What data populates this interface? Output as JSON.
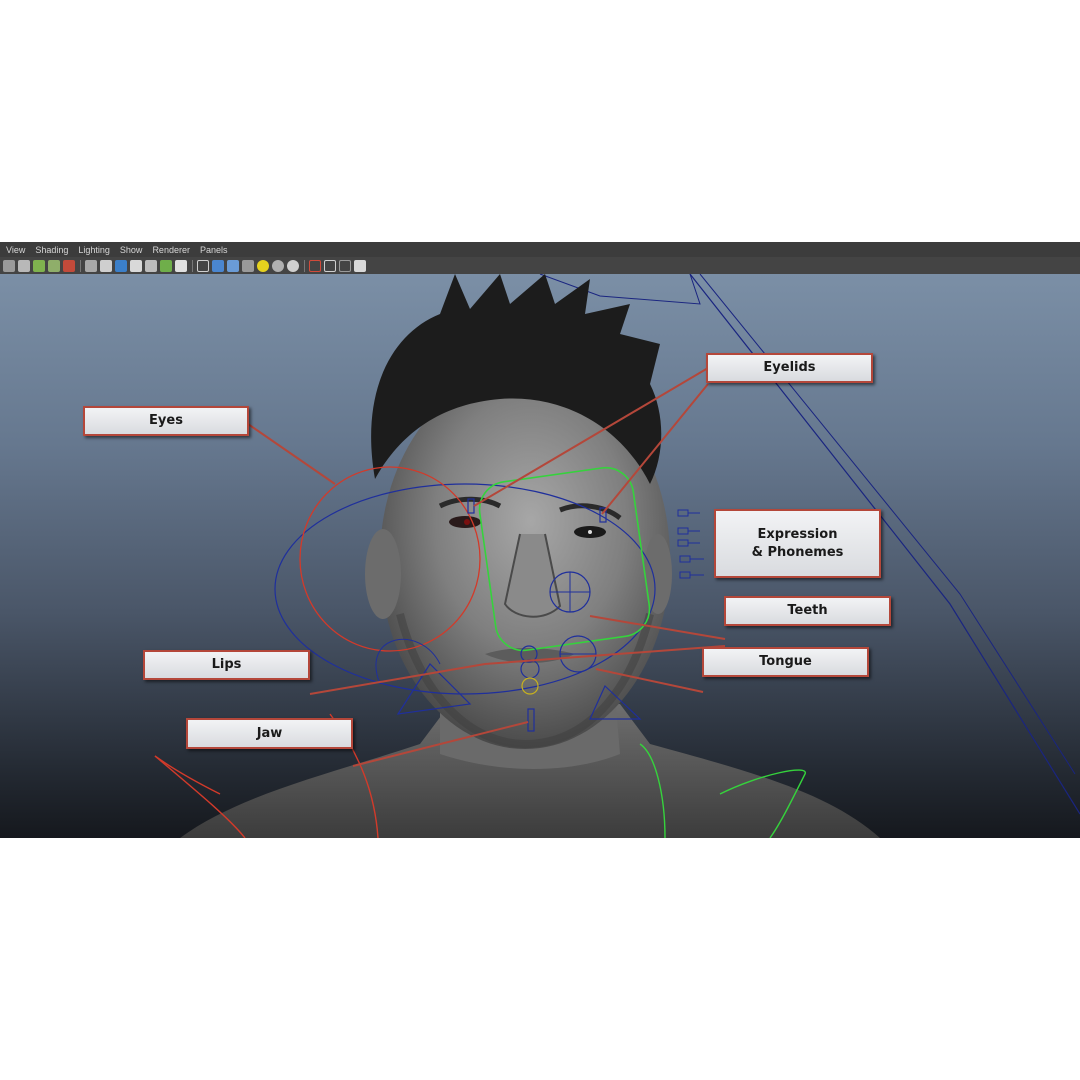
{
  "menu": [
    "View",
    "Shading",
    "Lighting",
    "Show",
    "Renderer",
    "Panels"
  ],
  "toolbar_icons": [
    "camera-select-icon",
    "camera-attributes-icon",
    "bookmark-icon",
    "image-plane-icon",
    "2d-pan-zoom-icon",
    "separator",
    "grid-icon",
    "film-gate-icon",
    "resolution-gate-icon",
    "gate-mask-icon",
    "field-chart-icon",
    "safe-action-icon",
    "safe-title-icon",
    "separator",
    "wireframe-icon",
    "smooth-shade-icon",
    "shaded-wireframe-icon",
    "textured-icon",
    "use-all-lights-icon",
    "shadows-icon",
    "screen-space-ao-icon",
    "separator",
    "isolate-select-icon",
    "xray-icon",
    "xray-joints-icon",
    "xray-active-icon"
  ],
  "callouts": {
    "eyes": "Eyes",
    "eyelids": "Eyelids",
    "expression": "Expression\n& Phonemes",
    "teeth": "Teeth",
    "lips": "Lips",
    "tongue": "Tongue",
    "jaw": "Jaw"
  },
  "colors": {
    "callout_border": "#b4473a",
    "callout_leader": "#b4473a",
    "control_blue": "#1f2f9c",
    "control_red": "#d23a2a",
    "control_green": "#35d33c"
  }
}
